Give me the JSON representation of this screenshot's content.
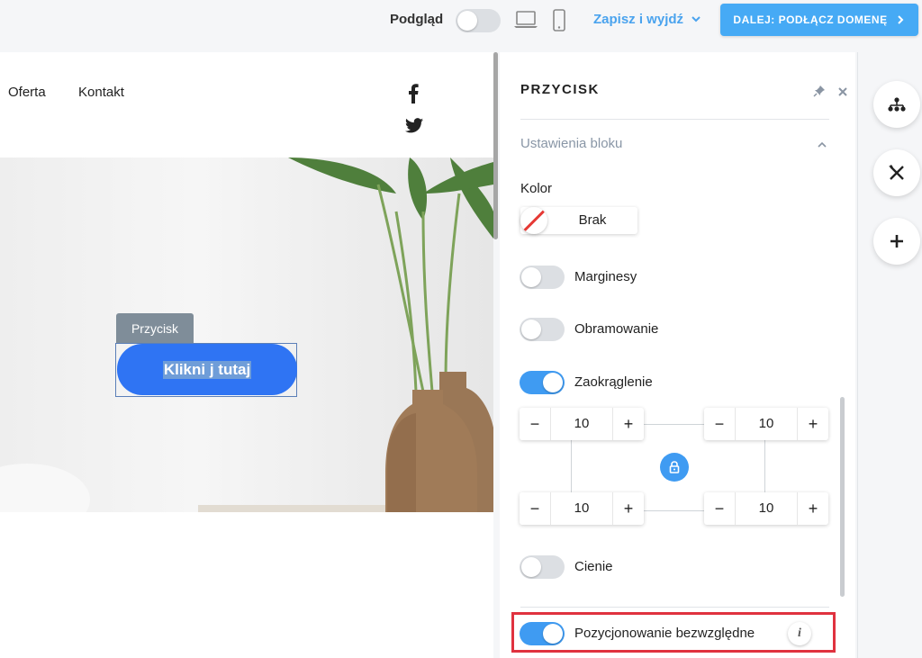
{
  "topbar": {
    "preview_label": "Podgląd",
    "preview_toggle_on": false,
    "save_exit_label": "Zapisz i wyjdź",
    "next_button_label": "DALEJ: PODŁĄCZ DOMENĘ"
  },
  "canvas": {
    "nav": [
      "Oferta",
      "Kontakt"
    ],
    "social_icons": [
      "facebook-icon",
      "twitter-icon"
    ],
    "element_tag": "Przycisk",
    "button_label": "Klikni j tutaj"
  },
  "panel": {
    "title": "PRZYCISK",
    "section_title": "Ustawienia bloku",
    "color_label": "Kolor",
    "color_value": "Brak",
    "toggles": [
      {
        "label": "Marginesy",
        "on": false
      },
      {
        "label": "Obramowanie",
        "on": false
      },
      {
        "label": "Zaokrąglenie",
        "on": true
      },
      {
        "label": "Cienie",
        "on": false
      },
      {
        "label": "Pozycjonowanie bezwzględne",
        "on": true
      }
    ],
    "radius": {
      "top_left": "10",
      "top_right": "10",
      "bottom_left": "10",
      "bottom_right": "10"
    },
    "info_glyph": "i"
  },
  "rail": [
    "sitemap-icon",
    "tools-icon",
    "add-icon"
  ],
  "colors": {
    "accent": "#3f9bf2",
    "button": "#2f74f3",
    "highlight": "#e0323f"
  }
}
